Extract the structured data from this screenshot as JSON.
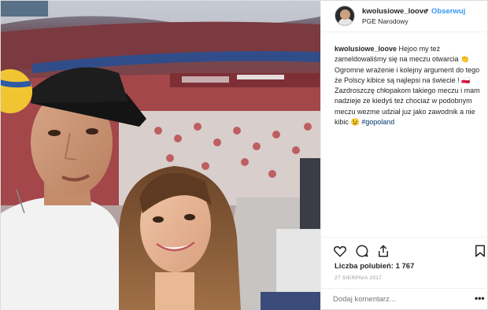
{
  "post": {
    "username": "kwolusiowe_loove",
    "separator": "•",
    "follow_label": "Obserwuj",
    "location": "PGE Narodowy",
    "caption": {
      "username": "kwolusiowe_loove",
      "line1": "Hejoo my też zameldowaliśmy się na meczu otwarcia 👏",
      "line2": "Ogromne wrażenie i kolejny argument do tego że Polscy kibice są najlepsi na świecie ! 🇵🇱 Zazdroszczę chłopakom takiego meczu i mam nadzieje ze kiedyś też chociaż w podobnym meczu wezme udział juz jako zawodnik a nie kibic 😉",
      "hashtag": "#gopoland"
    },
    "likes_label": "Liczba polubień:",
    "likes_count": "1 767",
    "date": "27 SIERPNIA 2017",
    "comment_placeholder": "Dodaj komentarz...",
    "more_label": "•••"
  },
  "icons": {
    "like": "heart-icon",
    "comment": "comment-icon",
    "share": "share-icon",
    "save": "bookmark-icon"
  },
  "colors": {
    "link_blue": "#3897f0",
    "hashtag": "#003569",
    "muted": "#999999",
    "text": "#262626",
    "border": "#efefef"
  }
}
